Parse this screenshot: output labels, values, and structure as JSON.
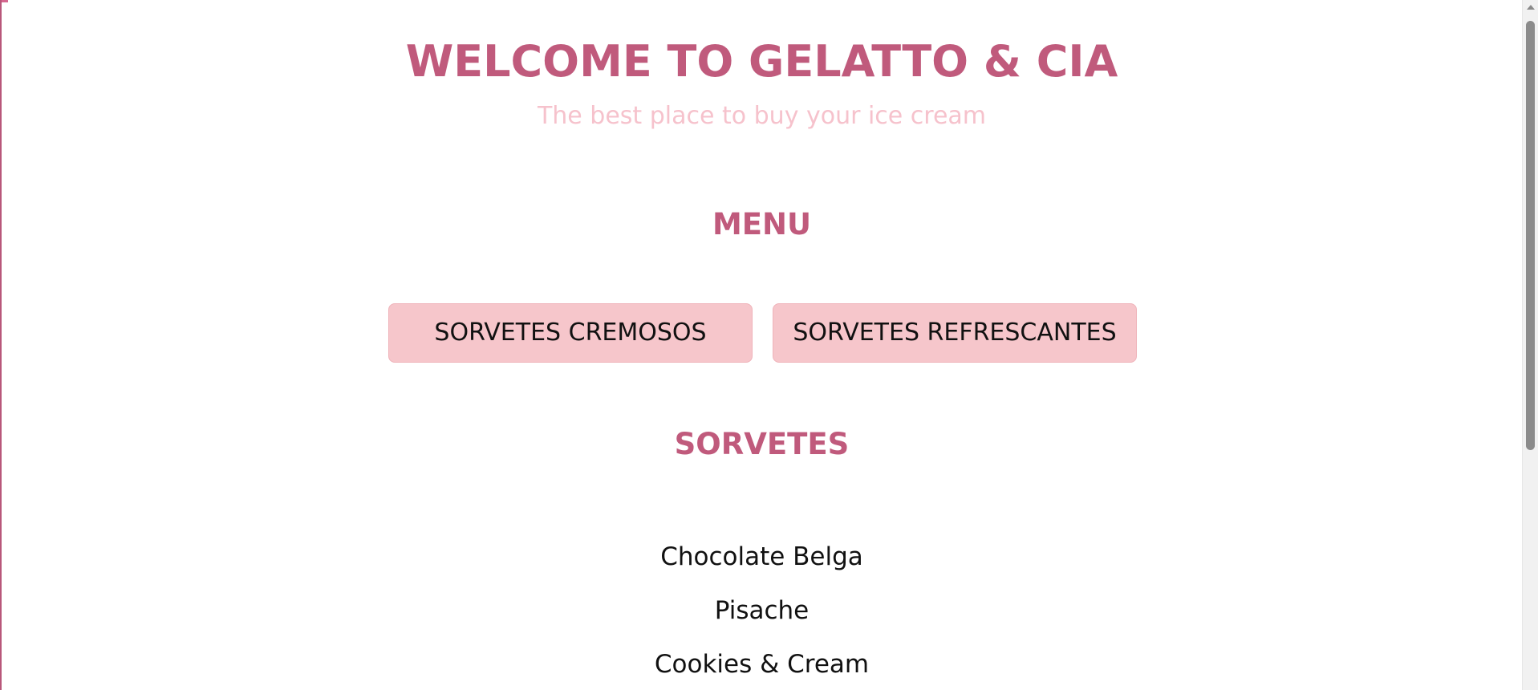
{
  "header": {
    "title": "WELCOME TO GELATTO & CIA",
    "subtitle": "The best place to buy your ice cream"
  },
  "menu": {
    "heading": "MENU",
    "buttons": [
      {
        "label": "SORVETES CREMOSOS"
      },
      {
        "label": "SORVETES REFRESCANTES"
      }
    ]
  },
  "sorvetes": {
    "heading": "SORVETES",
    "items": [
      {
        "label": "Chocolate Belga"
      },
      {
        "label": "Pisache"
      },
      {
        "label": "Cookies & Cream"
      }
    ]
  },
  "colors": {
    "accent": "#c05a7c",
    "subtitle": "#f6c2cc",
    "button_bg": "#f6c6cb"
  }
}
